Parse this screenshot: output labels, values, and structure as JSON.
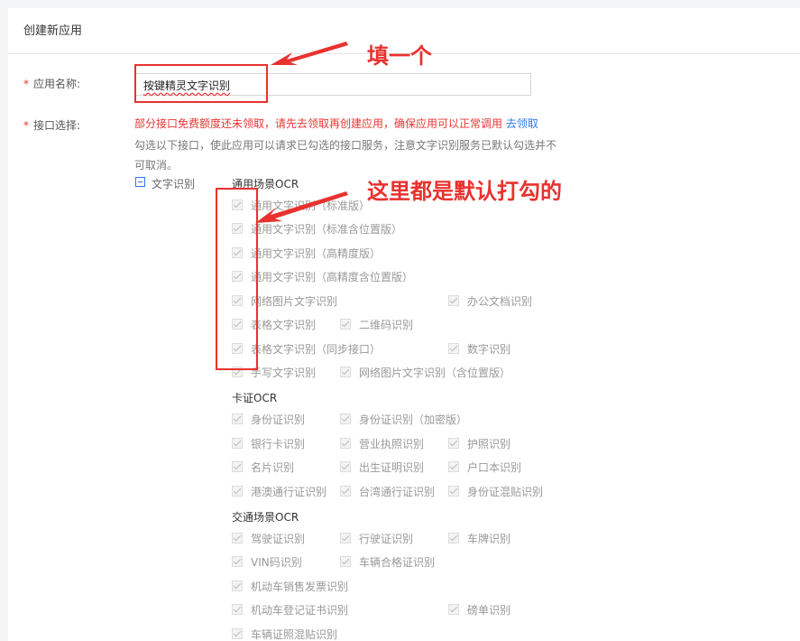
{
  "page": {
    "title": "创建新应用"
  },
  "form": {
    "name_label": "应用名称:",
    "name_value": "按键精灵文字识别",
    "api_label": "接口选择:",
    "notice_text": "部分接口免费额度还未领取，请先去领取再创建应用，确保应用可以正常调用",
    "notice_link": "去领取",
    "desc_text": "勾选以下接口，使此应用可以请求已勾选的接口服务，注意文字识别服务已默认勾选并不可取消。",
    "tree_label": "文字识别"
  },
  "groups": [
    {
      "title": "通用场景OCR",
      "items": [
        "通用文字识别（标准版）",
        "通用文字识别（标准含位置版）",
        "通用文字识别（高精度版）",
        "通用文字识别（高精度含位置版）",
        "网络图片文字识别",
        "办公文档识别",
        "表格文字识别",
        "二维码识别",
        "表格文字识别（同步接口）",
        "数字识别",
        "手写文字识别",
        "网络图片文字识别（含位置版）"
      ]
    },
    {
      "title": "卡证OCR",
      "items": [
        "身份证识别",
        "身份证识别（加密版）",
        "银行卡识别",
        "营业执照识别",
        "护照识别",
        "名片识别",
        "出生证明识别",
        "户口本识别",
        "港澳通行证识别",
        "台湾通行证识别",
        "身份证混贴识别"
      ]
    },
    {
      "title": "交通场景OCR",
      "items": [
        "驾驶证识别",
        "行驶证识别",
        "车牌识别",
        "VIN码识别",
        "车辆合格证识别",
        "机动车销售发票识别",
        "机动车登记证书识别",
        "磅单识别",
        "车辆证照混贴识别"
      ]
    }
  ],
  "annotations": {
    "fill_one": "填一个",
    "default_checked": "这里都是默认打勾的",
    "color": "#e8322f"
  },
  "colors": {
    "link": "#2d78f4",
    "required": "#e33"
  }
}
